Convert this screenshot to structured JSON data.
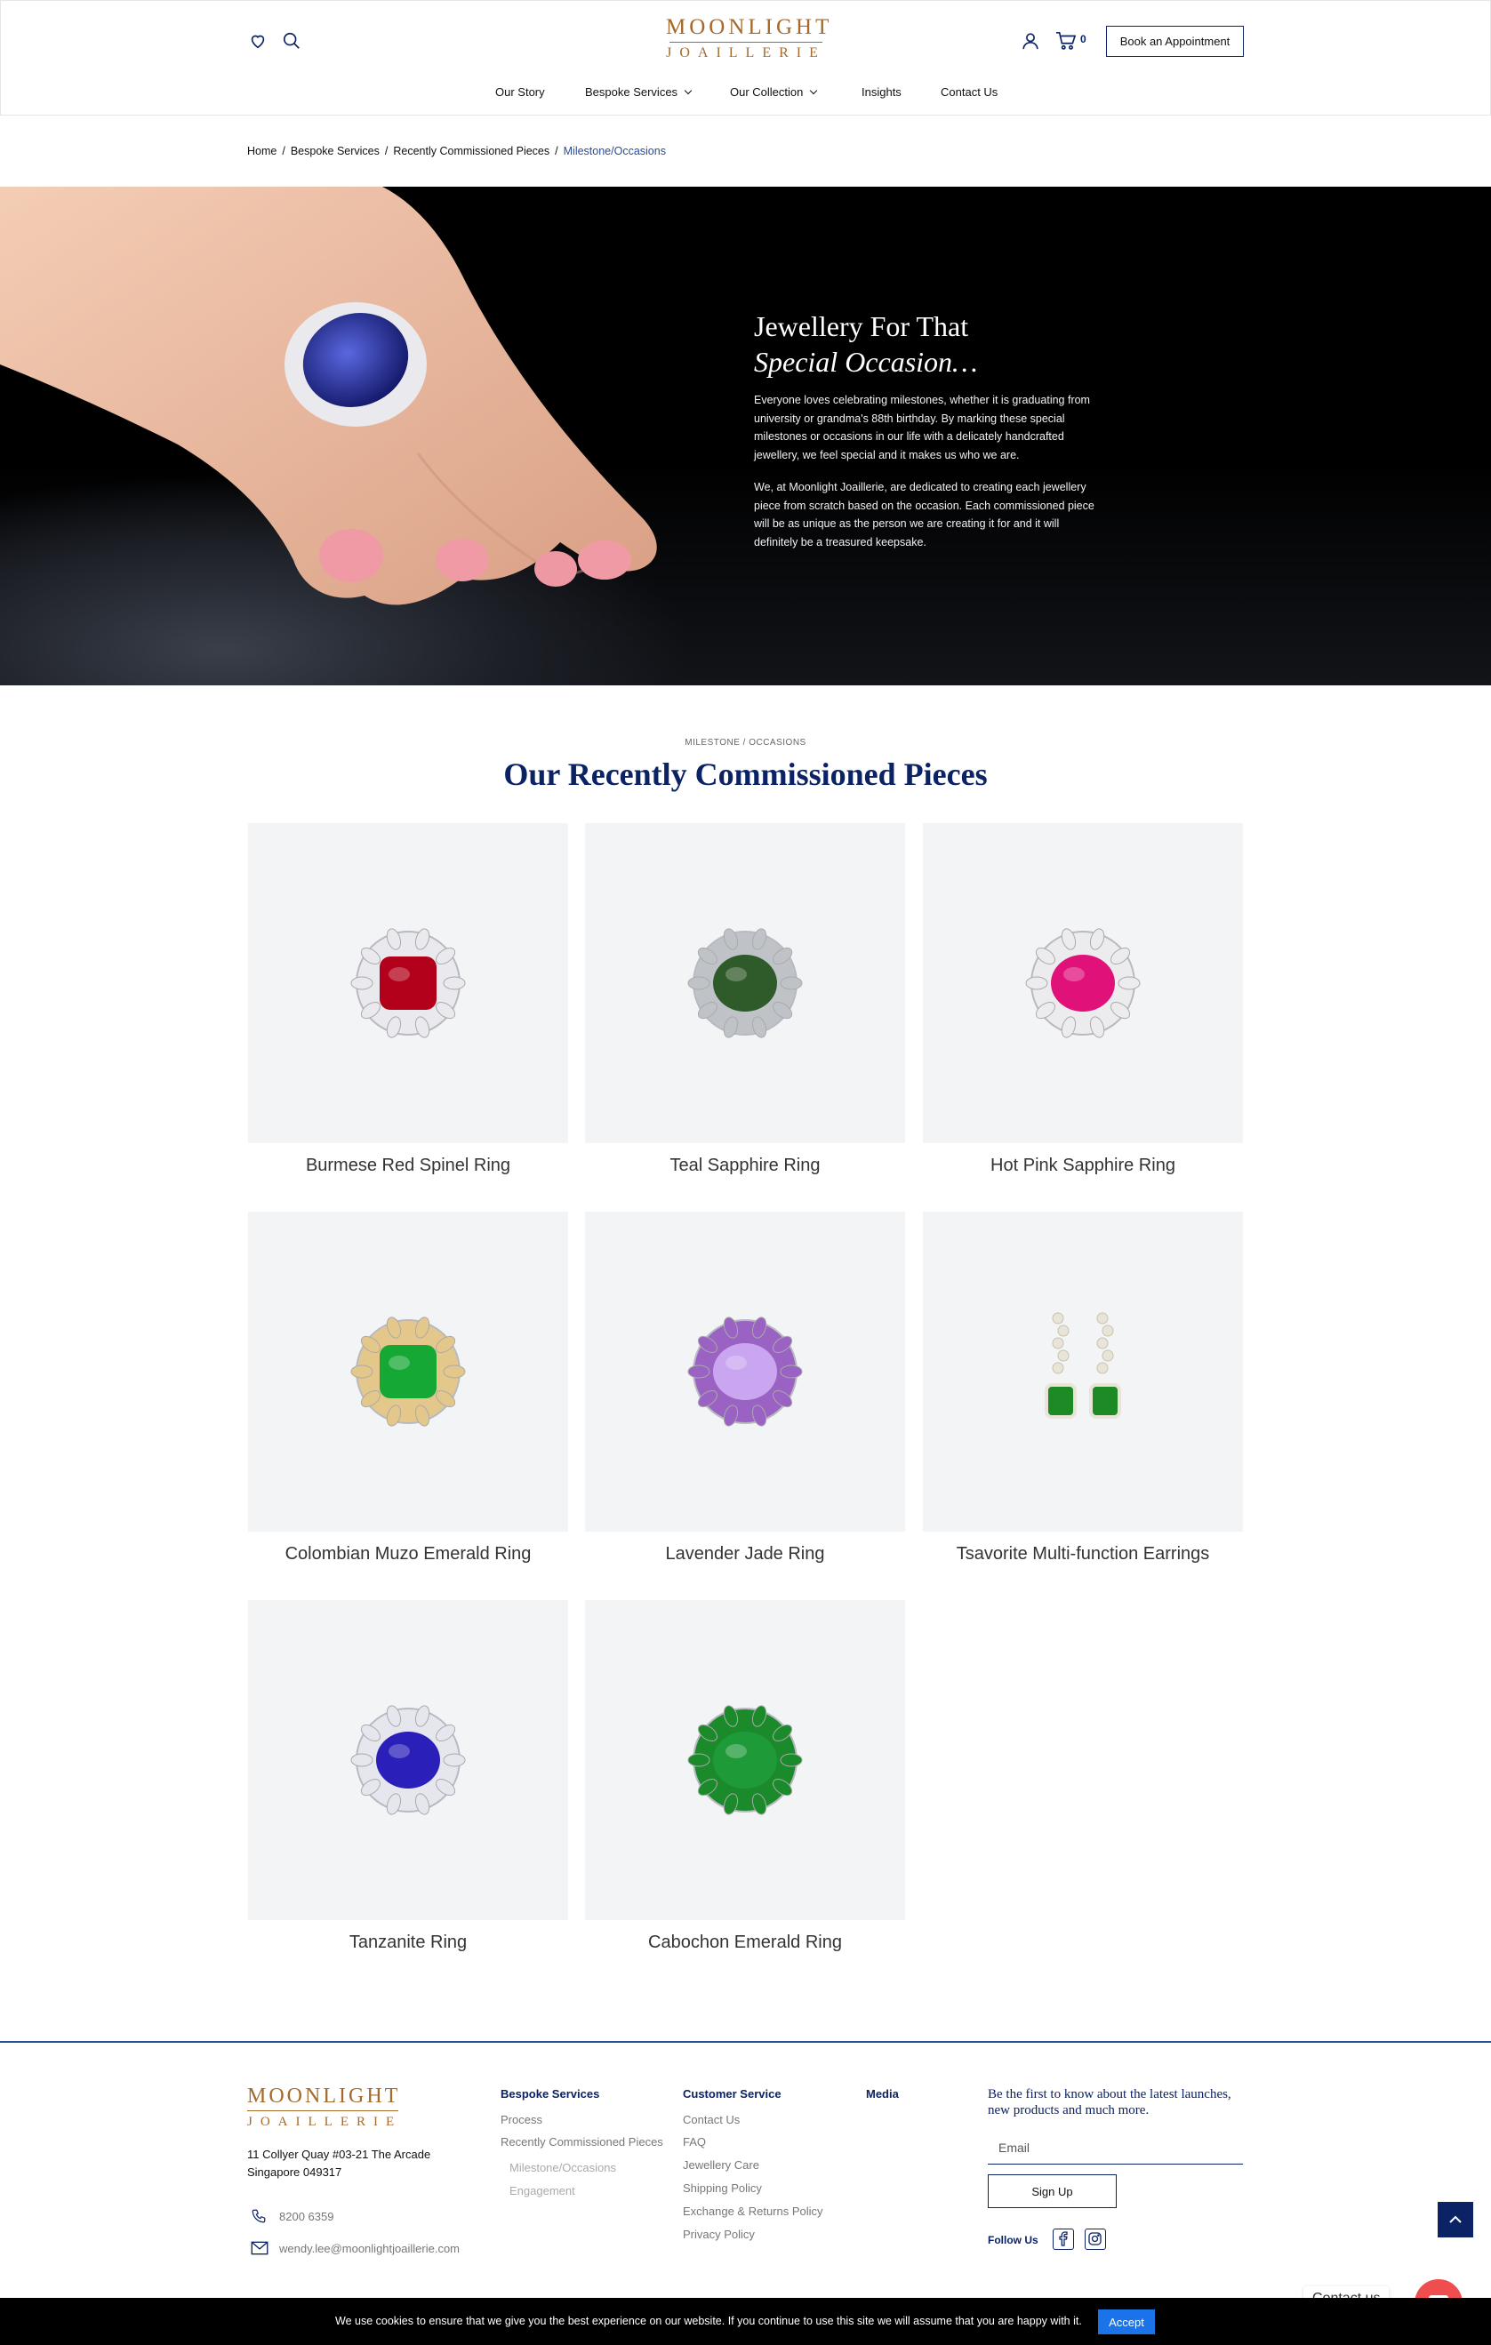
{
  "header": {
    "logo_line1": "MOONLIGHT",
    "logo_line2": "JOAILLERIE",
    "cart_count": "0",
    "appointment_label": "Book an Appointment",
    "nav": [
      {
        "label": "Our Story"
      },
      {
        "label": "Bespoke Services"
      },
      {
        "label": "Our Collection"
      },
      {
        "label": "Insights"
      },
      {
        "label": "Contact Us"
      }
    ],
    "icons": [
      "heart-icon",
      "search-icon",
      "user-icon",
      "cart-icon"
    ]
  },
  "breadcrumb": [
    "Home",
    "Bespoke Services",
    "Recently Commissioned Pieces",
    "Milestone/Occasions"
  ],
  "hero": {
    "title_line1": "Jewellery For That",
    "title_line2": "Special Occasion…",
    "para1": "Everyone loves celebrating milestones, whether it is graduating from university or grandma's 88th birthday. By marking these special milestones or occasions in our life with a delicately handcrafted jewellery, we feel special and it makes us who we are.",
    "para2": "We, at Moonlight Joaillerie, are dedicated to creating each jewellery piece from scratch based on the occasion. Each commissioned piece will be as unique as the person we are creating it for and it will definitely be a treasured keepsake."
  },
  "collection": {
    "eyebrow": "MILESTONE / OCCASIONS",
    "title": "Our Recently Commissioned Pieces",
    "items": [
      {
        "name": "Burmese Red Spinel Ring",
        "stone": "#b3001b",
        "accent": "#e9e9ee"
      },
      {
        "name": "Teal Sapphire Ring",
        "stone": "#2f5a2a",
        "accent": "#bfc3c8"
      },
      {
        "name": "Hot Pink Sapphire Ring",
        "stone": "#e0127a",
        "accent": "#ecebee"
      },
      {
        "name": "Colombian Muzo Emerald Ring",
        "stone": "#16a835",
        "accent": "#e4c78a"
      },
      {
        "name": "Lavender Jade Ring",
        "stone": "#c9a6ef",
        "accent": "#9a62c2"
      },
      {
        "name": "Tsavorite Multi-function Earrings",
        "stone": "#1e8a25",
        "accent": "#e9e4d8"
      },
      {
        "name": "Tanzanite Ring",
        "stone": "#2a1fb8",
        "accent": "#e6e6ee"
      },
      {
        "name": "Cabochon Emerald Ring",
        "stone": "#1f9a38",
        "accent": "#1a8a2a"
      }
    ]
  },
  "footer": {
    "logo_line1": "MOONLIGHT",
    "logo_line2": "JOAILLERIE",
    "address_line1": "11 Collyer Quay #03-21 The Arcade",
    "address_line2": "Singapore 049317",
    "phone": "8200 6359",
    "email": "wendy.lee@moonlightjoaillerie.com",
    "bespoke": {
      "heading": "Bespoke Services",
      "links": [
        "Process",
        "Recently Commissioned Pieces"
      ],
      "sublinks": [
        "Milestone/Occasions",
        "Engagement"
      ]
    },
    "customer": {
      "heading": "Customer Service",
      "links": [
        "Contact Us",
        "FAQ",
        "Jewellery Care",
        "Shipping Policy",
        "Exchange & Returns Policy",
        "Privacy Policy"
      ]
    },
    "media": {
      "heading": "Media"
    },
    "newsletter": "Be the first to know about the latest launches, new products and much more.",
    "email_placeholder": "Email",
    "signup_label": "Sign Up",
    "follow_label": "Follow Us"
  },
  "contact_widget": {
    "label": "Contact us"
  },
  "cookie": {
    "message": "We use cookies to ensure that we give you the best experience on our website. If you continue to use this site we will assume that you are happy with it.",
    "accept_label": "Accept"
  },
  "colors": {
    "brand_navy": "#0b2265",
    "brand_gold": "#a56a2a",
    "cookie_button": "#1a73e8"
  }
}
